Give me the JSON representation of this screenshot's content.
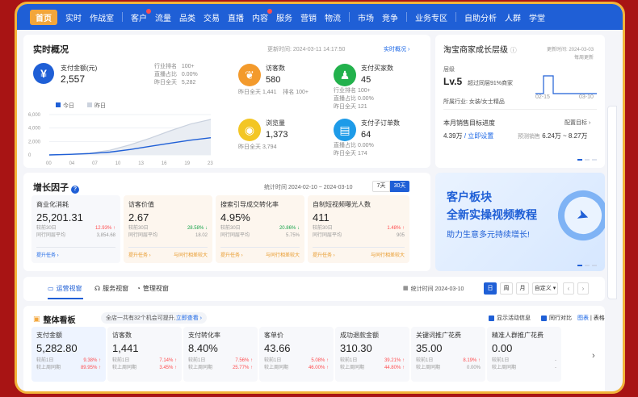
{
  "nav": {
    "items": [
      "首页",
      "实时",
      "作战室",
      "客户",
      "流量",
      "品类",
      "交易",
      "直播",
      "内容",
      "服务",
      "营销",
      "物流",
      "市场",
      "竞争",
      "业务专区",
      "自助分析",
      "人群",
      "学堂"
    ]
  },
  "realtime": {
    "title": "实时概况",
    "update": "更新时间: 2024-03-11 14:17:50",
    "link": "实时概况 ›",
    "pay": {
      "label": "支付金额(元)",
      "value": "2,557",
      "rank_label": "行业排名",
      "rank": "100+",
      "share_label": "直播占比",
      "share": "0.00%",
      "yest_label": "昨日全天",
      "yest": "5,282"
    },
    "legend": {
      "today": "今日",
      "yesterday": "昨日"
    },
    "chart_data": {
      "type": "area",
      "x": [
        "00",
        "04",
        "07",
        "10",
        "13",
        "16",
        "19",
        "23"
      ],
      "yticks": [
        "6,000",
        "4,000",
        "2,000",
        "0"
      ],
      "ylim": [
        0,
        6000
      ],
      "series": [
        {
          "name": "今日",
          "values": [
            0,
            80,
            200,
            420,
            800,
            1280,
            1750,
            2200,
            2557
          ]
        },
        {
          "name": "昨日",
          "values": [
            0,
            100,
            260,
            700,
            1500,
            2500,
            3600,
            4600,
            5282
          ]
        }
      ]
    },
    "visitors": {
      "label": "访客数",
      "value": "580",
      "yest_label": "昨日全天",
      "yest": "1,441",
      "rank_label": "排名",
      "rank": "100+"
    },
    "pv": {
      "label": "浏览量",
      "value": "1,373",
      "yest_label": "昨日全天",
      "yest": "3,794"
    },
    "buyers": {
      "label": "支付买家数",
      "value": "45",
      "rank_label": "行业排名",
      "rank": "100+",
      "share_label": "直播占比",
      "share": "0.00%",
      "yest_label": "昨日全天",
      "yest": "121"
    },
    "orders": {
      "label": "支付子订单数",
      "value": "64",
      "share_label": "直播占比",
      "share": "0.00%",
      "yest_label": "昨日全天",
      "yest": "174"
    }
  },
  "level": {
    "title": "淘宝商家成长层级",
    "update": "更新时间: 2024-03-03",
    "freq": "每周更新",
    "level_label": "层级",
    "level": "Lv.5",
    "beat": "超过同层91%商家",
    "industry": "所属行业: 女装/女士精品",
    "x_start": "02-15",
    "x_end": "03-10",
    "target_title": "本月销售目标进度",
    "target_link": "配置目标 ›",
    "target_value": "4.39万",
    "target_set": "/ 立即设置",
    "forecast_label": "预测销售",
    "forecast": "6.24万 ~ 8.27万"
  },
  "growth": {
    "title": "增长因子",
    "period": "统计时间 2024-02-10 ~ 2024-03-10",
    "btn7": "7天",
    "btn30": "30天",
    "items": [
      {
        "label": "商业化消耗",
        "value": "25,201.31",
        "r1": "较前30日",
        "v1": "12.93%",
        "r2": "同行同层平均",
        "v2": "3,854.68",
        "foot": "提升任务 ›"
      },
      {
        "label": "访客价值",
        "value": "2.67",
        "r1": "较前30日",
        "v1": "28.58%",
        "r2": "同行同层平均",
        "v2": "18.02",
        "foot": "提升任务 ›",
        "foot2": "与同行相差较大"
      },
      {
        "label": "搜索引导成交转化率",
        "value": "4.95%",
        "r1": "较前30日",
        "v1": "20.86%",
        "r2": "同行同层平均",
        "v2": "5.75%",
        "foot": "提升任务 ›",
        "foot2": "与同行相差较大"
      },
      {
        "label": "自制短视频曝光人数",
        "value": "411",
        "r1": "较前30日",
        "v1": "1.48%",
        "r2": "同行同层平均",
        "v2": "905",
        "foot": "提升任务 ›",
        "foot2": "与同行相差较大"
      }
    ]
  },
  "banner": {
    "line1": "客户板块",
    "line2": "全新实操视频教程",
    "line3": "助力生意多元持续增长!"
  },
  "tabs": {
    "items": [
      "运营视窗",
      "服务视窗",
      "管理视窗"
    ],
    "period": "统计时间 2024-03-10",
    "day": "日",
    "week": "周",
    "month": "月",
    "custom": "自定义"
  },
  "board": {
    "title": "整体看板",
    "tip": "全店一共有32个机会可提升,",
    "tip_link": "立即查看 ›",
    "opt1": "显示活动信息",
    "opt2": "同行对比",
    "chart_view": "图表",
    "table_view": "表格",
    "metrics": [
      {
        "label": "支付金额",
        "value": "5,282.80",
        "r1": "较前1日",
        "v1": "9.38%",
        "r2": "较上周同期",
        "v2": "89.95%"
      },
      {
        "label": "访客数",
        "value": "1,441",
        "r1": "较前1日",
        "v1": "7.14%",
        "r2": "较上周同期",
        "v2": "3.45%"
      },
      {
        "label": "支付转化率",
        "value": "8.40%",
        "r1": "较前1日",
        "v1": "7.56%",
        "r2": "较上周同期",
        "v2": "25.77%"
      },
      {
        "label": "客单价",
        "value": "43.66",
        "r1": "较前1日",
        "v1": "5.08%",
        "r2": "较上周同期",
        "v2": "46.00%"
      },
      {
        "label": "成功退款金额",
        "value": "310.30",
        "r1": "较前1日",
        "v1": "39.21%",
        "r2": "较上周同期",
        "v2": "44.80%"
      },
      {
        "label": "关键词推广花费",
        "value": "35.00",
        "r1": "较前1日",
        "v1": "8.19%",
        "r2": "较上周同期",
        "v2": "0.00%"
      },
      {
        "label": "精准人群推广花费",
        "value": "0.00",
        "r1": "较前1日",
        "v1": "-",
        "r2": "较上周同期",
        "v2": "-"
      }
    ]
  },
  "colors": {
    "brand": "#1f5fd6",
    "accent": "#f2a63b",
    "up": "#ff4d4f",
    "down": "#16a34a"
  }
}
